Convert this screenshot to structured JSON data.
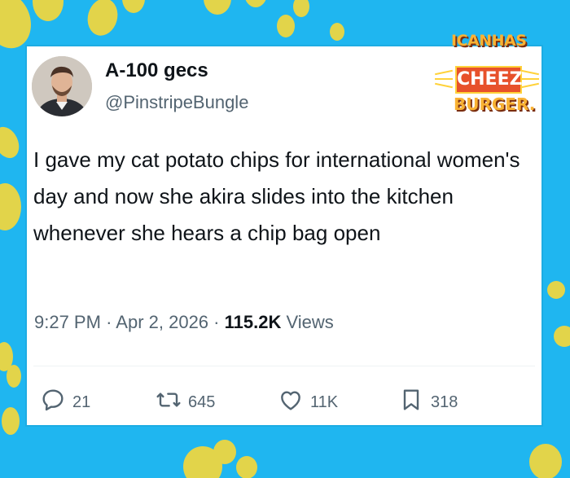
{
  "brand": {
    "logo_line1": "ICANHAS",
    "logo_line2": "CHEEZ",
    "logo_line3": "BURGER."
  },
  "tweet": {
    "display_name": "A-100 gecs",
    "handle": "@PinstripeBungle",
    "text": "I gave my cat potato chips for international women's day and now she akira slides into the kitchen whenever she hears a chip bag open",
    "time": "9:27 PM",
    "separator": "·",
    "date": "Apr 2, 2026",
    "views_count": "115.2K",
    "views_label": "Views"
  },
  "actions": {
    "replies": "21",
    "retweets": "645",
    "likes": "11K",
    "bookmarks": "318"
  },
  "colors": {
    "background": "#1fb6f0",
    "paw": "#e2d44a",
    "text_primary": "#0f1419",
    "text_secondary": "#536471"
  }
}
